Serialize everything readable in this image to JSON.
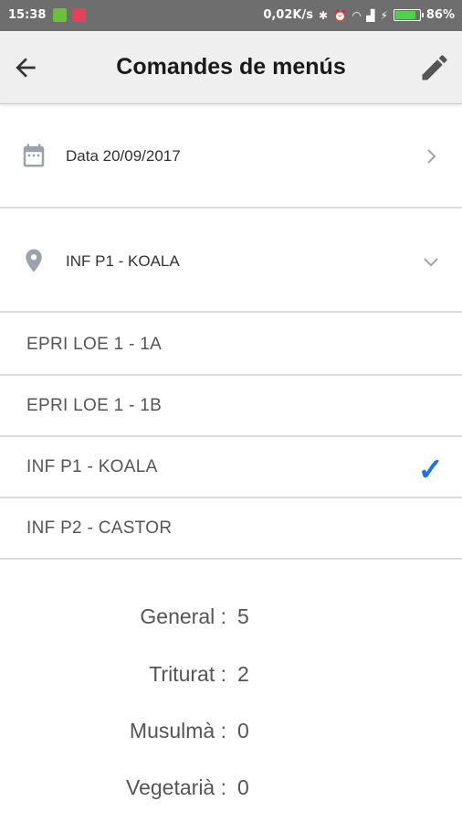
{
  "status_bar": {
    "time": "15:38",
    "speed": "0,02K/s",
    "battery": "86%",
    "battery_level": 0.86
  },
  "app_bar": {
    "title": "Comandes de menús",
    "back_icon": "arrow-left-icon",
    "edit_icon": "pencil-icon"
  },
  "date_row": {
    "label": "Data 20/09/2017",
    "icon": "calendar-icon",
    "chevron": "chevron-right-icon"
  },
  "location_row": {
    "label": "INF P1 - KOALA",
    "icon": "map-pin-icon",
    "chevron": "chevron-down-icon"
  },
  "groups": [
    {
      "label": "EPRI LOE 1 - 1A",
      "selected": false
    },
    {
      "label": "EPRI LOE 1 - 1B",
      "selected": false
    },
    {
      "label": "INF P1 - KOALA",
      "selected": true,
      "check": "✓"
    },
    {
      "label": "INF P2 - CASTOR",
      "selected": false
    }
  ],
  "menu_counts": [
    {
      "label": "General :",
      "value": "5"
    },
    {
      "label": "Triturat :",
      "value": "2"
    },
    {
      "label": "Musulmà :",
      "value": "0"
    },
    {
      "label": "Vegetarià :",
      "value": "0"
    }
  ],
  "colors": {
    "status_bar": "#6e6e6e",
    "app_bar": "#efefef",
    "accent": "#1a73e8",
    "divider": "#dcdcdc"
  }
}
